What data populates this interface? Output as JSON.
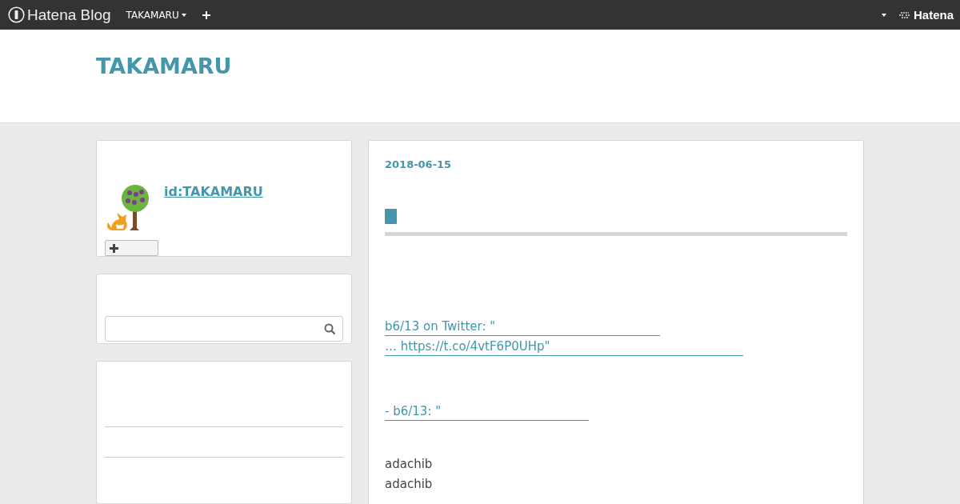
{
  "top_bar": {
    "logo": "Hatena Blog",
    "blog_menu": "TAKAMARU",
    "right_logo": "Hatena"
  },
  "header": {
    "title": "TAKAMARU"
  },
  "profile": {
    "user_id": "id:TAKAMARU"
  },
  "entry": {
    "date": "2018-06-15",
    "links": [
      {
        "text": "b6/13 on Twitter: \""
      },
      {
        "text": "… https://t.co/4vtF6P0UHp\""
      },
      {
        "text": " - b6/13: \""
      }
    ],
    "lines": [
      "adachib",
      "adachib"
    ]
  }
}
